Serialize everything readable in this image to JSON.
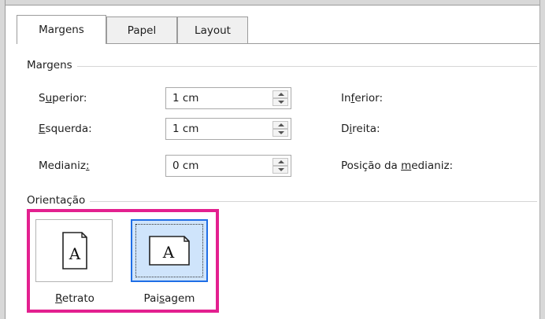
{
  "tabs": [
    {
      "label": "Margens",
      "active": true
    },
    {
      "label": "Papel",
      "active": false
    },
    {
      "label": "Layout",
      "active": false
    }
  ],
  "margins_group": {
    "title": "Margens",
    "fields": [
      {
        "label_pre": "S",
        "label_key": "u",
        "label_post": "perior:",
        "value": "1 cm"
      },
      {
        "label_pre": "",
        "label_key": "E",
        "label_post": "squerda:",
        "value": "1 cm"
      },
      {
        "label_pre": "Medianiz",
        "label_key": ":",
        "label_post": "",
        "value": "0 cm"
      }
    ],
    "right_labels": [
      {
        "pre": "In",
        "key": "f",
        "post": "erior:"
      },
      {
        "pre": "D",
        "key": "i",
        "post": "reita:"
      },
      {
        "pre": "Posição da ",
        "key": "m",
        "post": "edianiz:"
      }
    ]
  },
  "orientation_group": {
    "title": "Orientação",
    "options": [
      {
        "pre": "",
        "key": "R",
        "post": "etrato",
        "icon_letter": "A",
        "selected": false
      },
      {
        "pre": "Pai",
        "key": "s",
        "post": "agem",
        "icon_letter": "A",
        "selected": true
      }
    ],
    "highlight_color": "#e3208f"
  }
}
